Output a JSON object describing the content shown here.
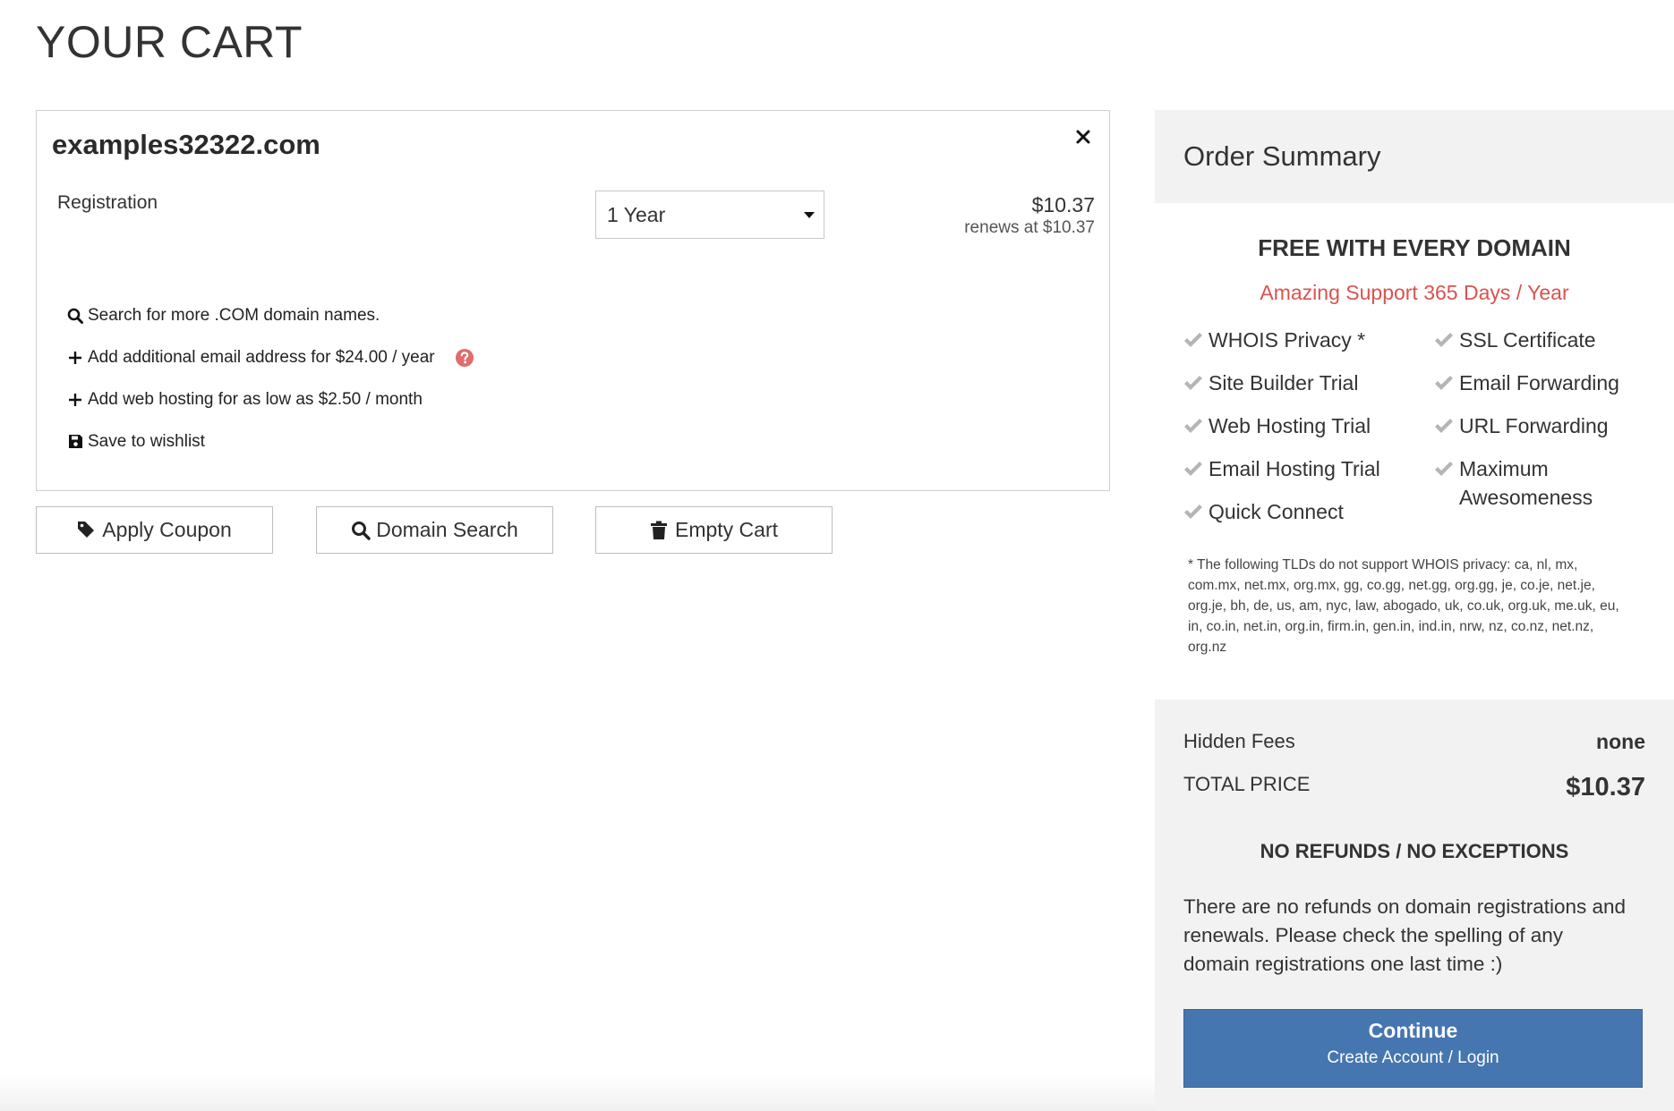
{
  "page": {
    "title": "YOUR CART"
  },
  "cart_item": {
    "domain": "examples32322.com",
    "product_label": "Registration",
    "term_selected": "1 Year",
    "price": "$10.37",
    "renews": "renews at $10.37",
    "actions": [
      {
        "label": "Search for more .COM domain names.",
        "icon": "search-icon"
      },
      {
        "label": "Add additional email address for $24.00 / year",
        "icon": "plus-icon"
      },
      {
        "label": "Add web hosting for as low as $2.50 / month",
        "icon": "plus-icon"
      },
      {
        "label": "Save to wishlist",
        "icon": "save-icon"
      }
    ]
  },
  "buttons": {
    "apply_coupon": "Apply Coupon",
    "domain_search": "Domain Search",
    "empty_cart": "Empty Cart"
  },
  "summary": {
    "title": "Order Summary",
    "free_heading": "FREE WITH EVERY DOMAIN",
    "support_line": "Amazing Support 365 Days / Year",
    "features_left": [
      "WHOIS Privacy *",
      "Site Builder Trial",
      "Web Hosting Trial",
      "Email Hosting Trial",
      "Quick Connect"
    ],
    "features_right": [
      "SSL Certificate",
      "Email Forwarding",
      "URL Forwarding",
      "Maximum Awesomeness"
    ],
    "tld_note": "* The following TLDs do not support WHOIS privacy: ca, nl, mx, com.mx, net.mx, org.mx, gg, co.gg, net.gg, org.gg, je, co.je, net.je, org.je, bh, de, us, am, nyc, law, abogado, uk, co.uk, org.uk, me.uk, eu, in, co.in, net.in, org.in, firm.in, gen.in, ind.in, nrw, nz, co.nz, net.nz, org.nz"
  },
  "totals": {
    "hidden_fees_label": "Hidden Fees",
    "hidden_fees_value": "none",
    "total_label": "TOTAL PRICE",
    "total_value": "$10.37",
    "no_refunds_heading": "NO REFUNDS / NO EXCEPTIONS",
    "refund_text": "There are no refunds on domain registrations and renewals. Please check the spelling of any domain registrations one last time :)",
    "continue_label": "Continue",
    "continue_sub": "Create Account / Login"
  },
  "colors": {
    "accent_red": "#d9534f",
    "continue_blue": "#4676b0",
    "panel_gray": "#f2f2f2",
    "check_gray": "#b5b5b5"
  }
}
